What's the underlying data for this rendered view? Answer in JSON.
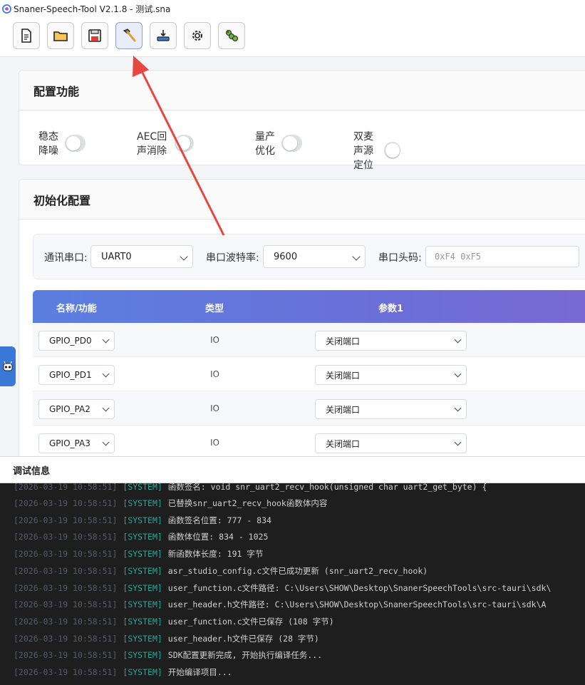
{
  "window": {
    "title": "Snaner-Speech-Tool V2.1.8 - 测试.sna"
  },
  "toolbar": {
    "buttons": [
      {
        "icon": "new-file-icon"
      },
      {
        "icon": "open-folder-icon"
      },
      {
        "icon": "save-icon"
      },
      {
        "icon": "hammer-icon",
        "active": true
      },
      {
        "icon": "download-flash-icon"
      },
      {
        "icon": "gear-icon"
      },
      {
        "icon": "caterpillar-icon"
      }
    ]
  },
  "config_features": {
    "title": "配置功能",
    "items": [
      {
        "label": "稳态降噪",
        "enabled": false
      },
      {
        "label": "AEC回声消除",
        "enabled": false
      },
      {
        "label": "量产优化",
        "enabled": false
      },
      {
        "label": "双麦声源定位",
        "enabled": false
      }
    ]
  },
  "init_config": {
    "title": "初始化配置",
    "port_label": "通讯串口:",
    "port_value": "UART0",
    "baud_label": "串口波特率:",
    "baud_value": "9600",
    "header_label": "串口头码:",
    "header_placeholder": "0xF4 0xF5",
    "table": {
      "columns": [
        "名称/功能",
        "类型",
        "参数1"
      ],
      "rows": [
        {
          "name": "GPIO_PD0",
          "type": "IO",
          "param1": "关闭端口"
        },
        {
          "name": "GPIO_PD1",
          "type": "IO",
          "param1": "关闭端口"
        },
        {
          "name": "GPIO_PA2",
          "type": "IO",
          "param1": "关闭端口"
        },
        {
          "name": "GPIO_PA3",
          "type": "IO",
          "param1": "关闭端口"
        }
      ]
    }
  },
  "debug": {
    "title": "调试信息",
    "logs": [
      {
        "ts": "[2026-03-19 10:58:51]",
        "tag": "[SYSTEM]",
        "msg": "函数签名: void snr_uart2_recv_hook(unsigned char uart2_get_byte) {"
      },
      {
        "ts": "[2026-03-19 10:58:51]",
        "tag": "[SYSTEM]",
        "msg": "已替换snr_uart2_recv_hook函数体内容"
      },
      {
        "ts": "[2026-03-19 10:58:51]",
        "tag": "[SYSTEM]",
        "msg": "函数签名位置: 777 - 834"
      },
      {
        "ts": "[2026-03-19 10:58:51]",
        "tag": "[SYSTEM]",
        "msg": "函数体位置: 834 - 1025"
      },
      {
        "ts": "[2026-03-19 10:58:51]",
        "tag": "[SYSTEM]",
        "msg": "新函数体长度: 191 字节"
      },
      {
        "ts": "[2026-03-19 10:58:51]",
        "tag": "[SYSTEM]",
        "msg": "asr_studio_config.c文件已成功更新 (snr_uart2_recv_hook)"
      },
      {
        "ts": "[2026-03-19 10:58:51]",
        "tag": "[SYSTEM]",
        "msg": "user_function.c文件路径: C:\\Users\\SHOW\\Desktop\\SnanerSpeechTools\\src-tauri\\sdk\\"
      },
      {
        "ts": "[2026-03-19 10:58:51]",
        "tag": "[SYSTEM]",
        "msg": "user_header.h文件路径: C:\\Users\\SHOW\\Desktop\\SnanerSpeechTools\\src-tauri\\sdk\\A"
      },
      {
        "ts": "[2026-03-19 10:58:51]",
        "tag": "[SYSTEM]",
        "msg": "user_function.c文件已保存 (108 字节)"
      },
      {
        "ts": "[2026-03-19 10:58:51]",
        "tag": "[SYSTEM]",
        "msg": "user_header.h文件已保存 (28 字节)"
      },
      {
        "ts": "[2026-03-19 10:58:51]",
        "tag": "[SYSTEM]",
        "msg": "SDK配置更新完成, 开始执行编译任务..."
      },
      {
        "ts": "[2026-03-19 10:58:51]",
        "tag": "[SYSTEM]",
        "msg": "开始编译项目..."
      }
    ]
  },
  "colors": {
    "table_header_start": "#5b7fe0",
    "table_header_end": "#7a68d2",
    "annotation_arrow": "#e8473f",
    "side_tab": "#3a78d8",
    "console_bg": "#1e1e1e",
    "log_tag": "#2aa59a"
  }
}
